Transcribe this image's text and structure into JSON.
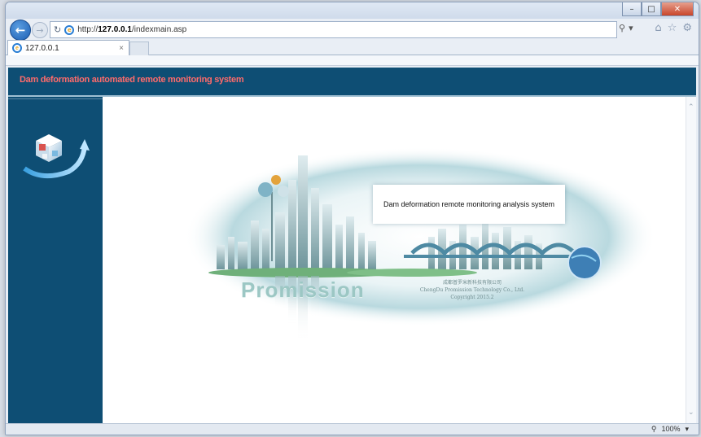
{
  "browser": {
    "url_prefix": "http://",
    "url_host": "127.0.0.1",
    "url_path": "/indexmain.asp",
    "tab_title": "127.0.0.1",
    "tab_close": "×",
    "zoom_level": "100%",
    "window_buttons": {
      "minimize": "–",
      "maximize": "□",
      "close": "✕"
    },
    "icons": [
      "back-arrow-icon",
      "forward-arrow-icon",
      "refresh-icon",
      "ie-logo-icon",
      "search-icon",
      "home-icon",
      "favorites-star-icon",
      "settings-gear-icon",
      "zoom-icon"
    ]
  },
  "app": {
    "header_title": "Dam deformation automated remote monitoring system",
    "message": "Dam deformation remote monitoring analysis system",
    "banner": {
      "brand": "Promission",
      "company_cn": "成都普罗米新科技有限公司",
      "company_en": "ChengDu Promission Technology Co., Ltd.",
      "copyright": "Copyright 2015.2"
    }
  },
  "colors": {
    "header_bg": "#0e4e74",
    "header_text": "#ff6b6b",
    "sidebar_bg": "#0e4e74"
  }
}
